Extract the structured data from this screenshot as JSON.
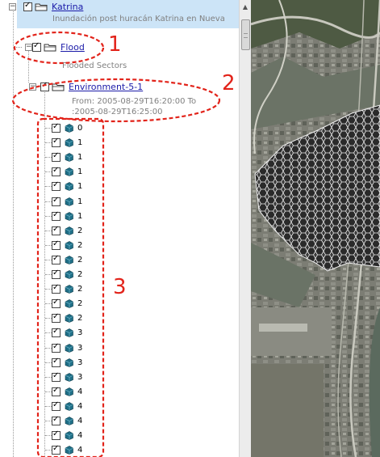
{
  "layers": {
    "katrina": {
      "title": "Katrina",
      "desc": "Inundación post huracán Katrina en Nueva Orleans"
    },
    "flood": {
      "title": "Flood",
      "desc": "Flooded Sectors"
    },
    "environment": {
      "title": "Environment-5-1",
      "desc_line1": "From: 2005-08-29T16:20:00 To",
      "desc_line2": ":2005-08-29T16:25:00"
    },
    "items": [
      "0",
      "1",
      "1",
      "1",
      "1",
      "1",
      "1",
      "2",
      "2",
      "2",
      "2",
      "2",
      "2",
      "2",
      "3",
      "3",
      "3",
      "3",
      "4",
      "4",
      "4",
      "4",
      "4"
    ]
  },
  "annotations": [
    "1",
    "2",
    "3"
  ],
  "icons": {
    "folder": "folder-icon",
    "cube": "cube-icon",
    "checkbox": "checkbox-icon",
    "expander": "minus-expander-icon"
  },
  "colors": {
    "selection": "#cce4f7",
    "link": "#1a1aa8",
    "annotation": "#e2231a",
    "cube": "#1f6f87"
  }
}
